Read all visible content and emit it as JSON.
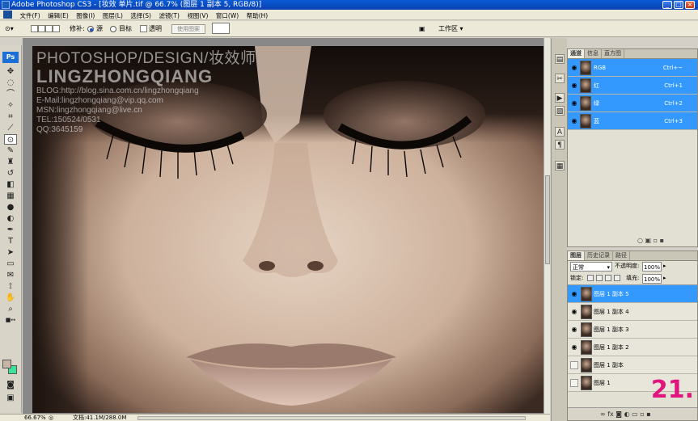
{
  "window": {
    "title": "Adobe Photoshop CS3 - [妆效 单片.tif @ 66.7% (图层 1 副本 5, RGB/8)]"
  },
  "menu": [
    "文件(F)",
    "编辑(E)",
    "图像(I)",
    "图层(L)",
    "选择(S)",
    "滤镜(T)",
    "视图(V)",
    "窗口(W)",
    "帮助(H)"
  ],
  "options": {
    "patch_label": "修补:",
    "source": "源",
    "target": "目标",
    "transparent": "透明",
    "use_pattern": "使用图案",
    "workspace": "工作区"
  },
  "watermark": {
    "line1": "PHOTOSHOP/DESIGN/妆效师",
    "line2": "LINGZHONGQIANG",
    "blog": "BLOG:http://blog.sina.com.cn/lingzhongqiang",
    "email": "E-Mail:lingzhongqiang@vip.qq.com",
    "msn": "MSN:lingzhongqiang@live.cn",
    "tel": "TEL:150524/0531",
    "qq": "QQ:3645159"
  },
  "step_badge": "21.",
  "status": {
    "zoom": "66.67%",
    "doc": "文档:41.1M/288.0M"
  },
  "channels_panel": {
    "tabs": [
      "通道",
      "信息",
      "直方图"
    ],
    "rows": [
      {
        "name": "RGB",
        "shortcut": "Ctrl+~"
      },
      {
        "name": "红",
        "shortcut": "Ctrl+1"
      },
      {
        "name": "绿",
        "shortcut": "Ctrl+2"
      },
      {
        "name": "蓝",
        "shortcut": "Ctrl+3"
      }
    ]
  },
  "layers_panel": {
    "tabs": [
      "图层",
      "历史记录",
      "路径"
    ],
    "blend_mode": "正常",
    "opacity_label": "不透明度:",
    "opacity": "100%",
    "lock_label": "锁定:",
    "fill_label": "填充:",
    "fill": "100%",
    "layers": [
      {
        "name": "图层 1 副本 5",
        "selected": true,
        "visible": true
      },
      {
        "name": "图层 1 副本 4",
        "selected": false,
        "visible": true
      },
      {
        "name": "图层 1 副本 3",
        "selected": false,
        "visible": true
      },
      {
        "name": "图层 1 副本 2",
        "selected": false,
        "visible": true
      },
      {
        "name": "图层 1 副本",
        "selected": false,
        "visible": false
      },
      {
        "name": "图层 1",
        "selected": false,
        "visible": false
      }
    ]
  }
}
